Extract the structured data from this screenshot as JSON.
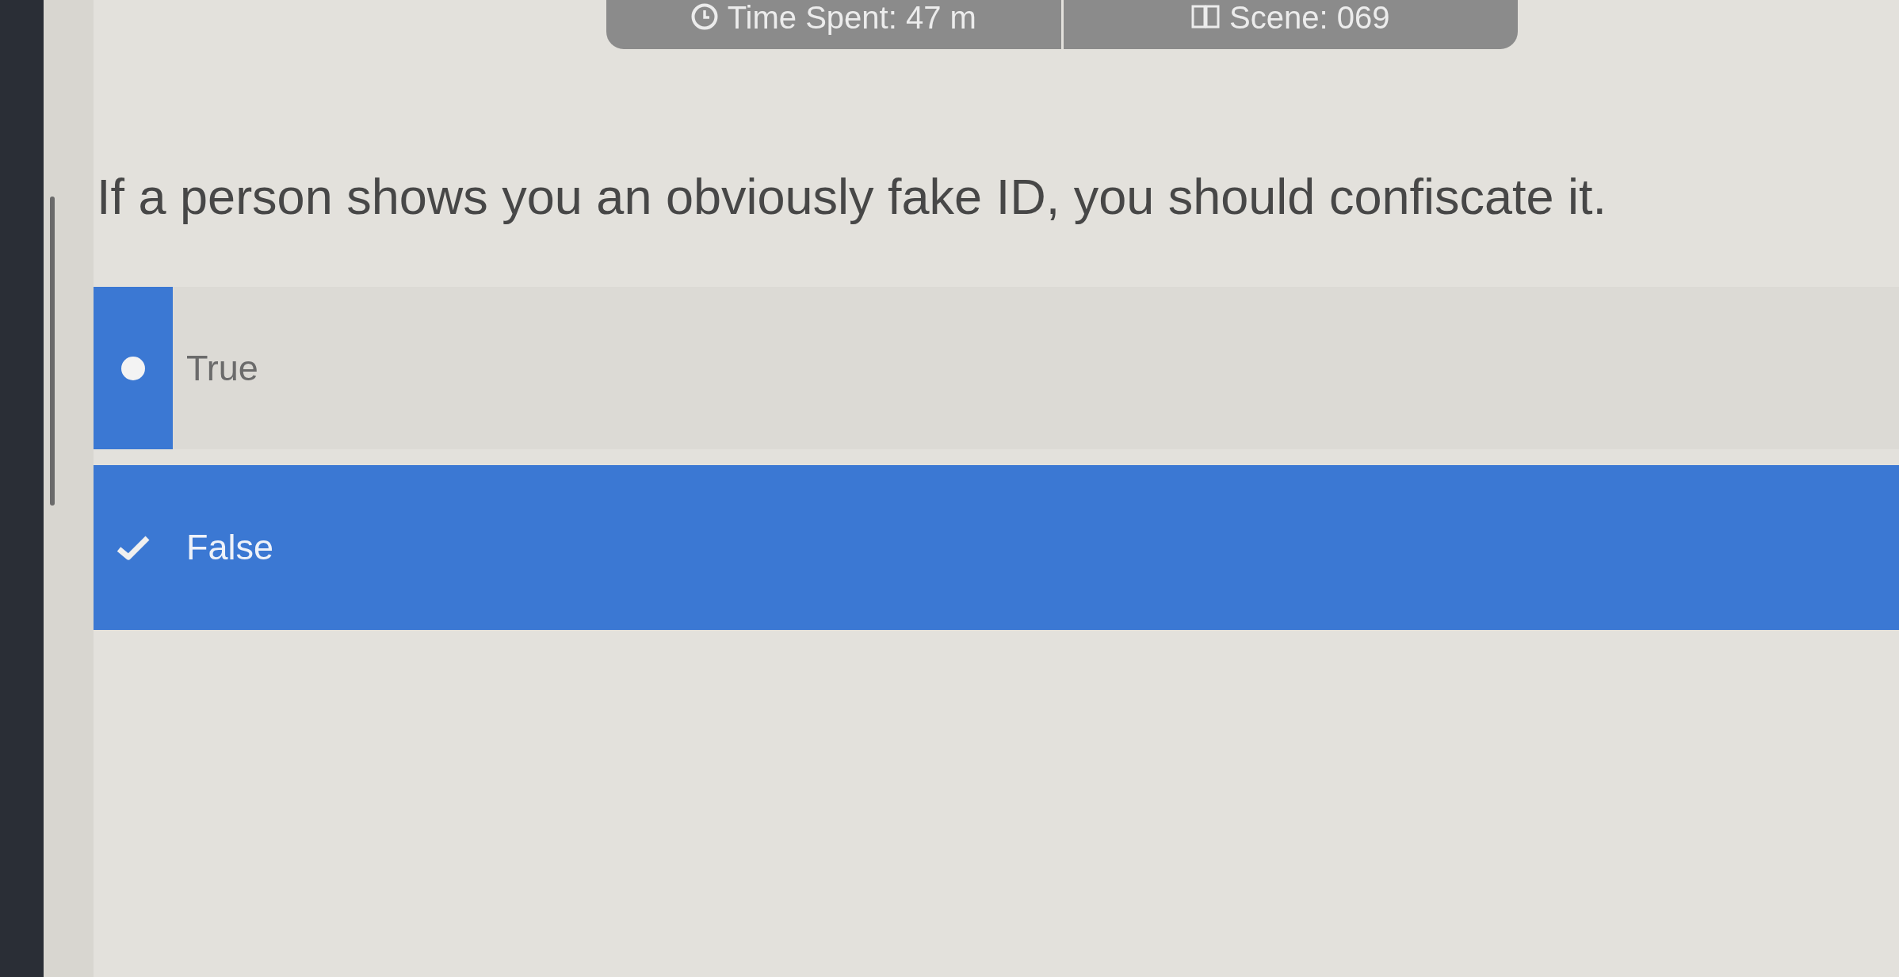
{
  "header": {
    "stats": [
      {
        "kind": "time",
        "label": "Time Spent: 47 m"
      },
      {
        "kind": "scene",
        "label": "Scene: 069"
      }
    ]
  },
  "question": {
    "text": "If a person shows you an obviously fake ID, you should confiscate it.",
    "options": [
      {
        "label": "True",
        "selected": false
      },
      {
        "label": "False",
        "selected": true
      }
    ]
  }
}
